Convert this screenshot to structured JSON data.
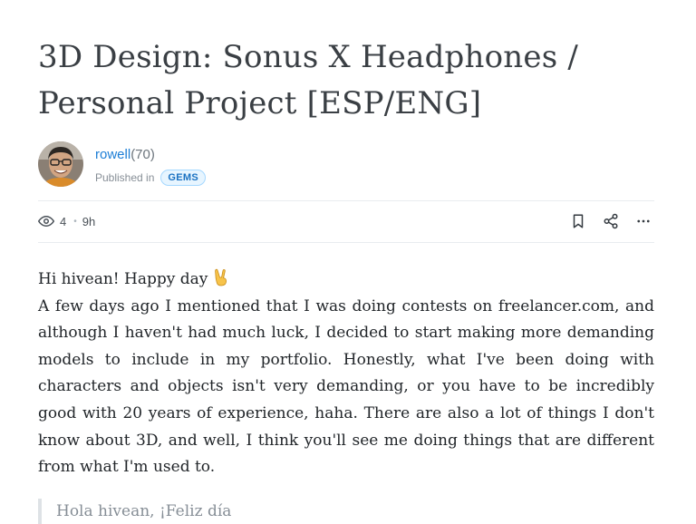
{
  "post": {
    "title": "3D Design: Sonus X Headphones / Personal Project [ESP/ENG]",
    "author": {
      "username": "rowell",
      "reputation": "(70)"
    },
    "published_label": "Published in",
    "community": "GEMS",
    "views": "4",
    "age": "9h"
  },
  "icons": {
    "views": "eye-icon",
    "bookmark": "bookmark-icon",
    "share": "share-icon",
    "more": "more-horizontal-icon",
    "greeting_emoji": "victory-hand-emoji"
  },
  "body": {
    "greeting": "Hi hivean! Happy day",
    "paragraph": "A few days ago I mentioned that I was doing contests on freelancer.com, and although I haven't had much luck, I decided to start making more demanding models to include in my portfolio. Honestly, what I've been doing with characters and objects isn't very demanding, or you have to be incredibly good with 20 years of experience, haha. There are also a lot of things I don't know about 3D, and well, I think you'll see me doing things that are different from what I'm used to.",
    "quote_partial": "Hola hivean, ¡Feliz día"
  },
  "colors": {
    "link": "#1c7ed6",
    "badge_text": "#1971c2",
    "badge_bg": "#e7f5ff",
    "title": "#3a3f44",
    "muted": "#868e96"
  }
}
